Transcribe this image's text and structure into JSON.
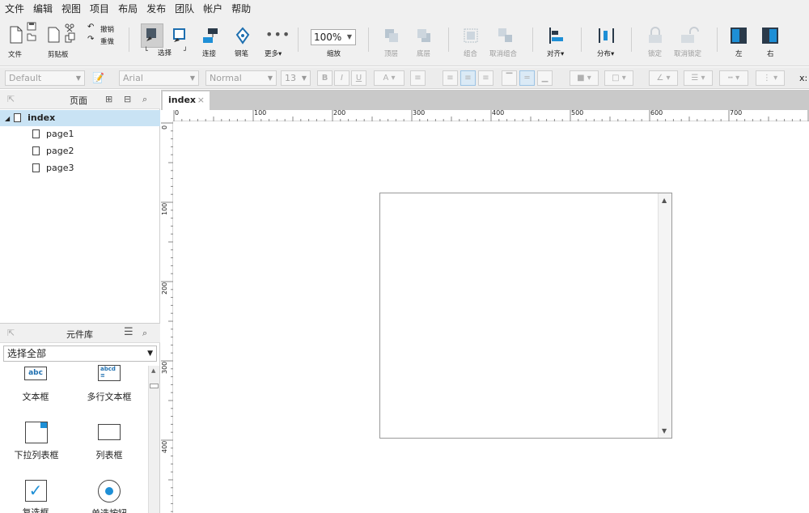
{
  "menu": [
    "文件",
    "编辑",
    "视图",
    "项目",
    "布局",
    "发布",
    "团队",
    "帐户",
    "帮助"
  ],
  "toolbar": {
    "file": "文件",
    "clipboard": "剪贴板",
    "undo": "撤销",
    "redo": "重做",
    "select": "选择",
    "connect": "连接",
    "pen": "钢笔",
    "more": "更多▾",
    "zoom_value": "100%",
    "zoom_label": "缩放",
    "top": "顶层",
    "bottom": "底层",
    "group": "组合",
    "ungroup": "取消组合",
    "align": "对齐▾",
    "distribute": "分布▾",
    "lock": "锁定",
    "unlock": "取消锁定",
    "left": "左",
    "right": "右"
  },
  "format": {
    "style": "Default",
    "font": "Arial",
    "weight": "Normal",
    "size": "13",
    "x_label": "x:"
  },
  "pages_panel": {
    "title": "页面",
    "root": "index",
    "pages": [
      "page1",
      "page2",
      "page3"
    ]
  },
  "library": {
    "title": "元件库",
    "filter": "选择全部",
    "widgets": [
      "文本框",
      "多行文本框",
      "下拉列表框",
      "列表框",
      "复选框",
      "单选按钮"
    ]
  },
  "canvas": {
    "tab": "index",
    "ruler_top": [
      "0",
      "100",
      "200",
      "300",
      "400",
      "500",
      "600",
      "700"
    ],
    "ruler_left": [
      "0",
      "100",
      "200",
      "300",
      "400"
    ]
  },
  "colors": {
    "accent": "#1e8fd6",
    "selection": "#c9e3f4"
  }
}
